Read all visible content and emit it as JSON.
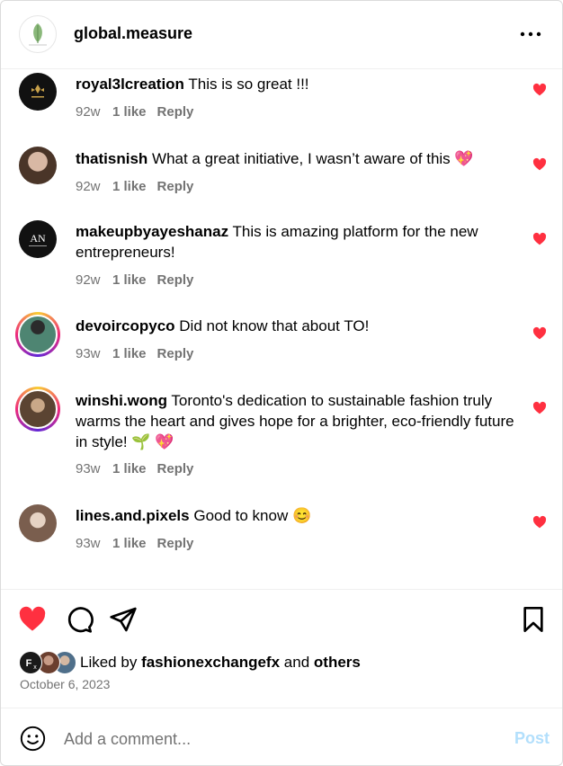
{
  "header": {
    "username": "global.measure",
    "more_icon": "more-horizontal-icon"
  },
  "comments": [
    {
      "user": "royal3lcreation",
      "text": "This is so great !!!",
      "time": "92w",
      "likes": "1 like",
      "reply": "Reply",
      "avatar_color": "#111111"
    },
    {
      "user": "thatisnish",
      "text": "What a great initiative, I wasn’t aware of this 💖",
      "time": "92w",
      "likes": "1 like",
      "reply": "Reply",
      "avatar_color": "#a58b7a"
    },
    {
      "user": "makeupbyayeshanaz",
      "text": "This is amazing platform for the new entrepreneurs!",
      "time": "92w",
      "likes": "1 like",
      "reply": "Reply",
      "avatar_color": "#111111"
    },
    {
      "user": "devoircopyco",
      "text": "Did not know that about TO!",
      "time": "93w",
      "likes": "1 like",
      "reply": "Reply",
      "avatar_color": "#3f6e60"
    },
    {
      "user": "winshi.wong",
      "text": "Toronto's dedication to sustainable fashion truly warms the heart and gives hope for a brighter, eco-friendly future in style! 🌱 💖",
      "time": "93w",
      "likes": "1 like",
      "reply": "Reply",
      "avatar_color": "#7a5a3e"
    },
    {
      "user": "lines.and.pixels",
      "text": "Good to know 😊",
      "time": "93w",
      "likes": "1 like",
      "reply": "Reply",
      "avatar_color": "#b89a88"
    }
  ],
  "actions": {
    "like_icon": "heart-filled-icon",
    "comment_icon": "comment-icon",
    "share_icon": "send-icon",
    "save_icon": "bookmark-icon"
  },
  "likes": {
    "prefix": "Liked by",
    "user": "fashionexchangefx",
    "connector": "and",
    "others": "others",
    "badge_text": "F",
    "badge_sub": "x"
  },
  "date": "October 6, 2023",
  "comment_box": {
    "placeholder": "Add a comment...",
    "post_label": "Post",
    "emoji_icon": "emoji-icon"
  },
  "colors": {
    "heart": "#ff3040",
    "muted_text": "#737373",
    "post_disabled": "#b2dffc",
    "leaf_green": "#8ab87a"
  }
}
